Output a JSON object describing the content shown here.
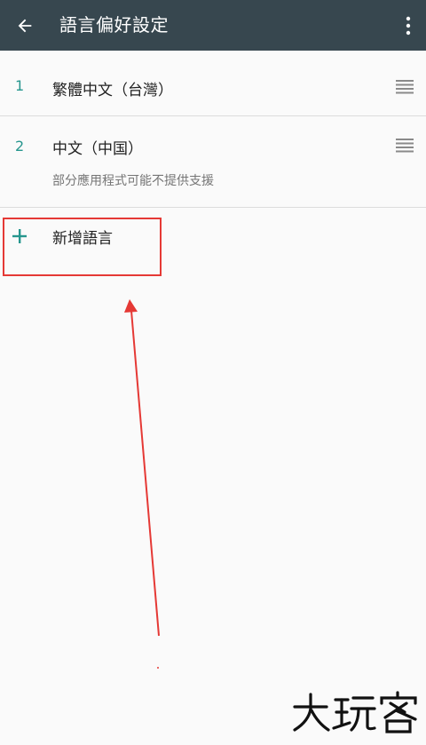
{
  "appbar": {
    "title": "語言偏好設定",
    "back_icon": "arrow-back-icon",
    "menu_icon": "more-vert-icon",
    "background": "#37474f"
  },
  "languages": [
    {
      "order": "1",
      "name": "繁體中文（台灣）",
      "note": ""
    },
    {
      "order": "2",
      "name": "中文（中国）",
      "note": "部分應用程式可能不提供支援"
    }
  ],
  "add_language": {
    "label": "新增語言",
    "icon": "plus-icon"
  },
  "annotation": {
    "highlight_color": "#e53935",
    "arrow_color": "#e53935"
  },
  "watermark": {
    "text": "大玩客"
  },
  "colors": {
    "accent": "#26968e",
    "text_primary": "#212121",
    "text_secondary": "#757575",
    "divider": "#dcdcdc"
  }
}
